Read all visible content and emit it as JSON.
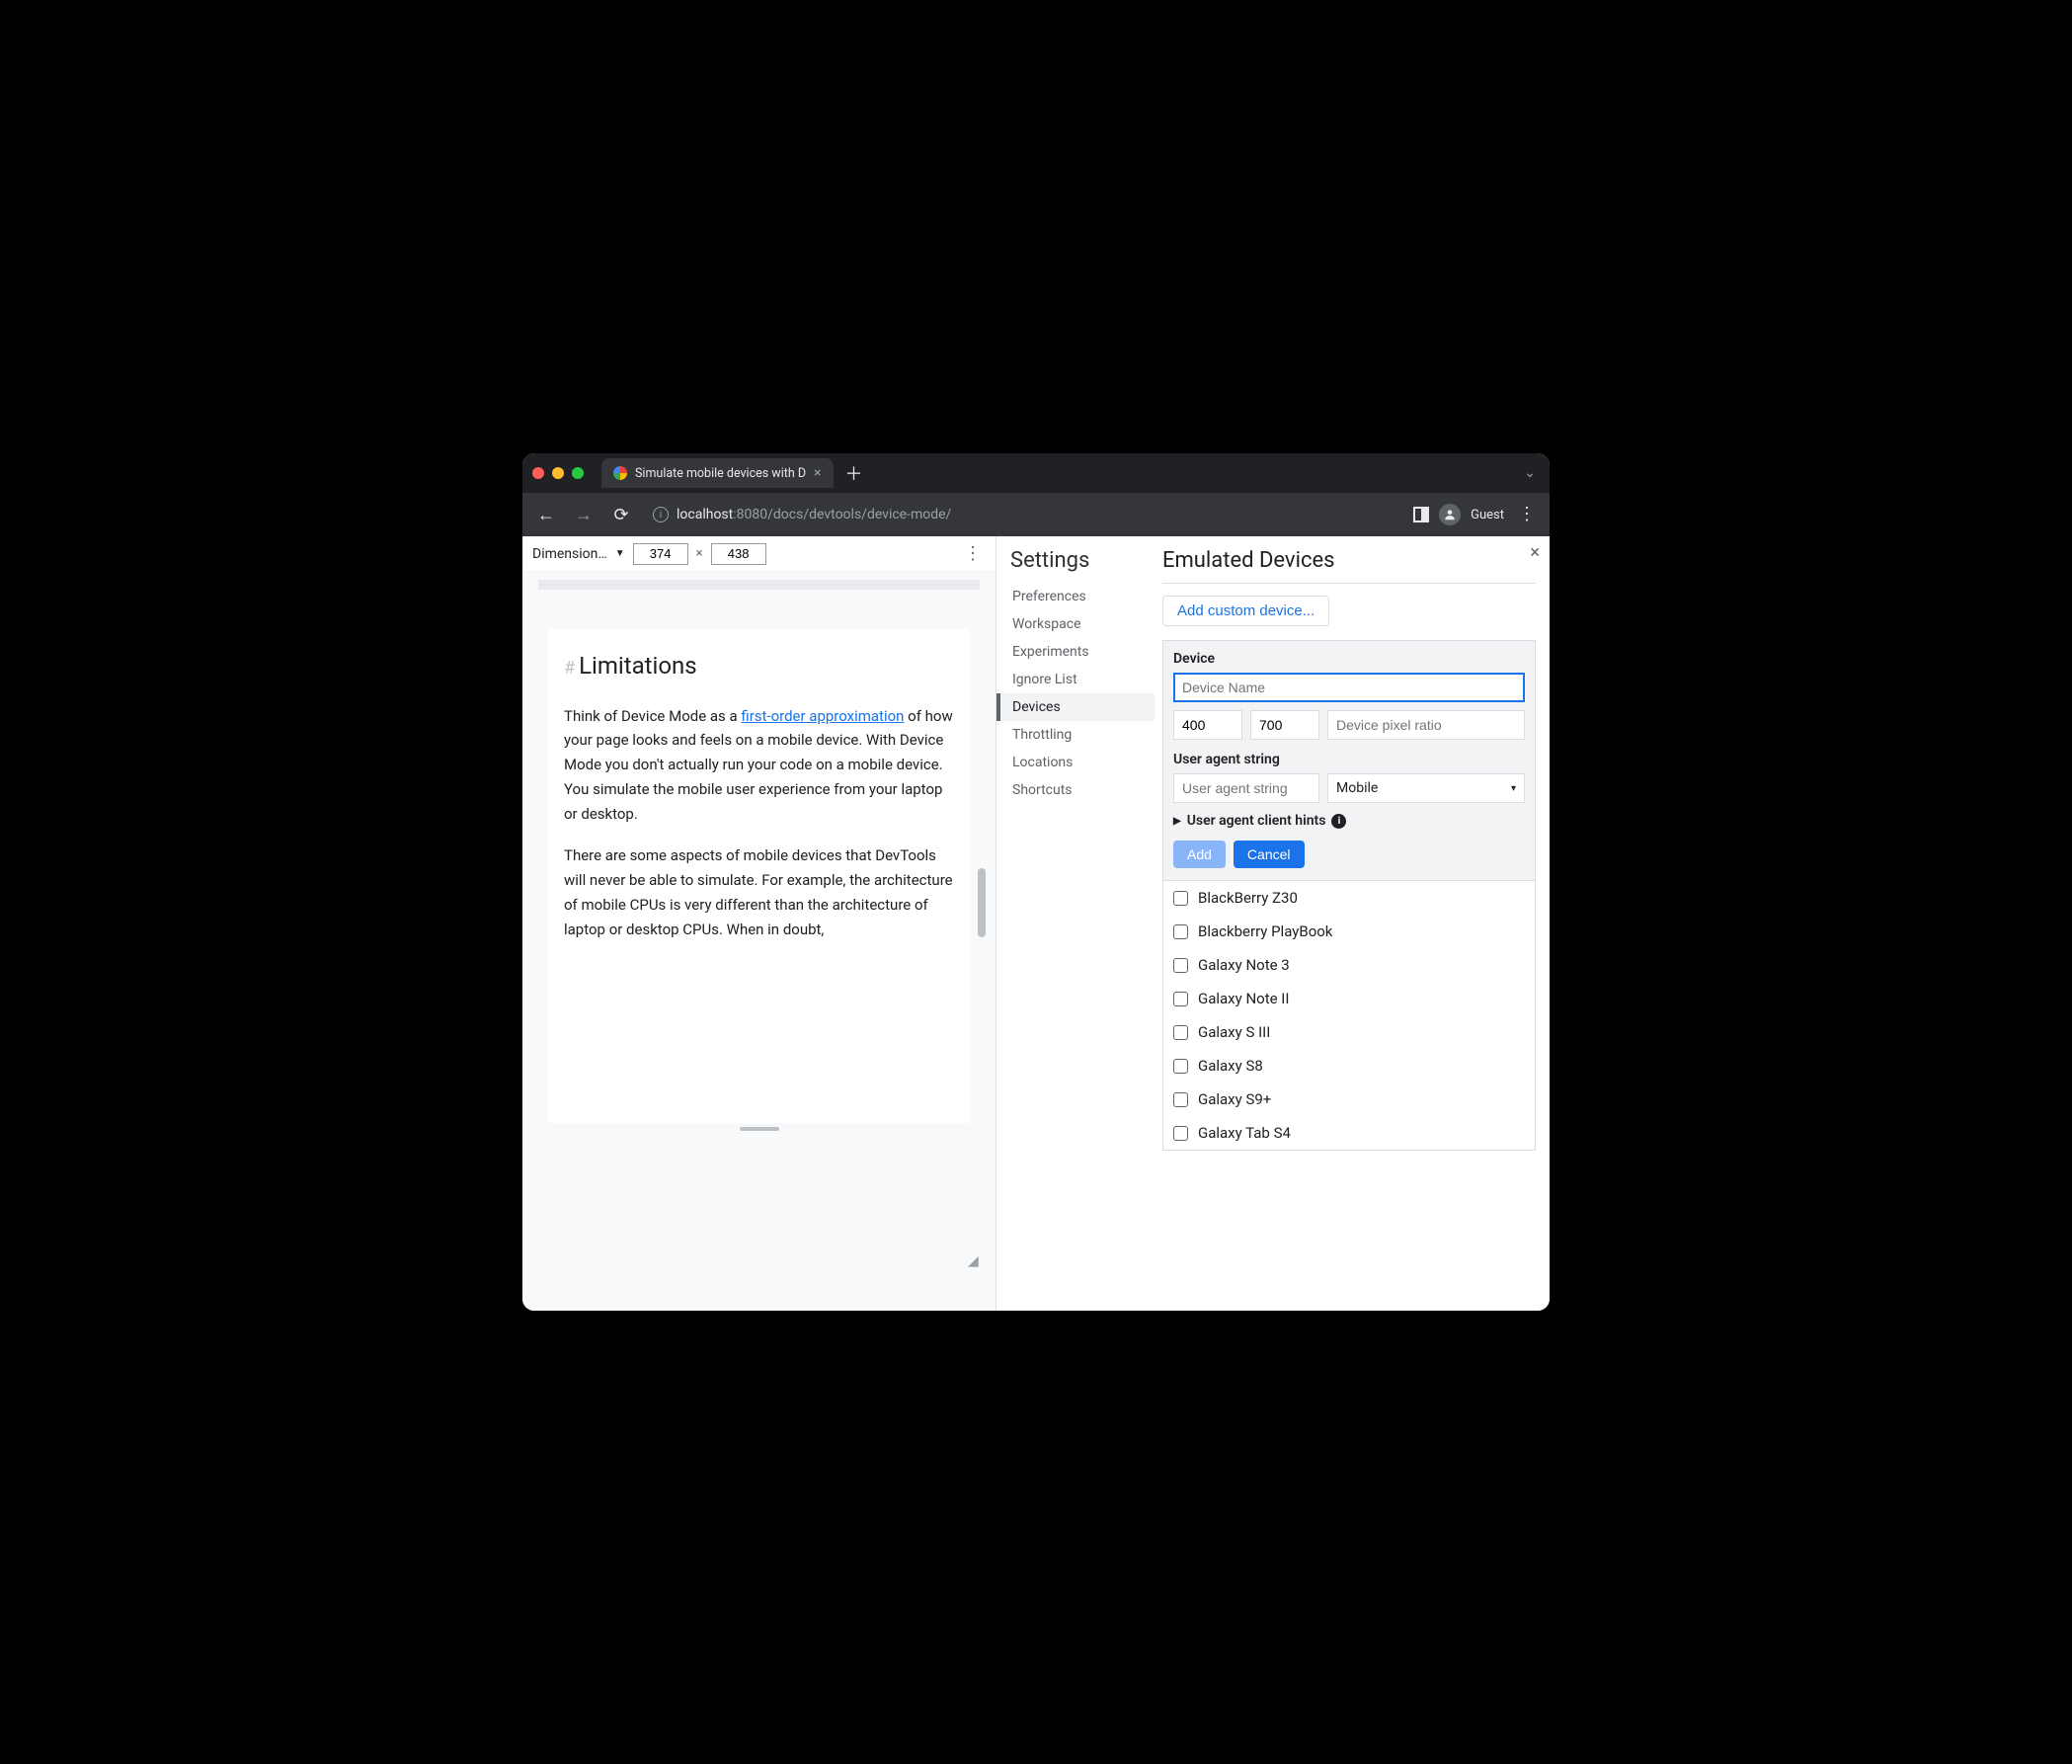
{
  "window": {
    "tab_title": "Simulate mobile devices with D",
    "url_host": "localhost",
    "url_port": ":8080",
    "url_path": "/docs/devtools/device-mode/",
    "guest_label": "Guest"
  },
  "viewport": {
    "dimensions_label": "Dimension…",
    "width": "374",
    "height": "438",
    "multiply": "×"
  },
  "page_content": {
    "hash": "#",
    "heading": "Limitations",
    "p1_pre": "Think of Device Mode as a ",
    "p1_link": "first-order approximation",
    "p1_post": " of how your page looks and feels on a mobile device. With Device Mode you don't actually run your code on a mobile device. You simulate the mobile user experience from your laptop or desktop.",
    "p2": "There are some aspects of mobile devices that DevTools will never be able to simulate. For example, the architecture of mobile CPUs is very different than the architecture of laptop or desktop CPUs. When in doubt,"
  },
  "settings": {
    "title": "Settings",
    "items": [
      "Preferences",
      "Workspace",
      "Experiments",
      "Ignore List",
      "Devices",
      "Throttling",
      "Locations",
      "Shortcuts"
    ],
    "active_index": 4
  },
  "emulated": {
    "title": "Emulated Devices",
    "add_custom": "Add custom device...",
    "device_label": "Device",
    "device_name_ph": "Device Name",
    "width": "400",
    "height": "700",
    "dpr_ph": "Device pixel ratio",
    "ua_label": "User agent string",
    "ua_ph": "User agent string",
    "ua_type": "Mobile",
    "hints_label": "User agent client hints",
    "add_btn": "Add",
    "cancel_btn": "Cancel",
    "devices": [
      "BlackBerry Z30",
      "Blackberry PlayBook",
      "Galaxy Note 3",
      "Galaxy Note II",
      "Galaxy S III",
      "Galaxy S8",
      "Galaxy S9+",
      "Galaxy Tab S4"
    ]
  }
}
